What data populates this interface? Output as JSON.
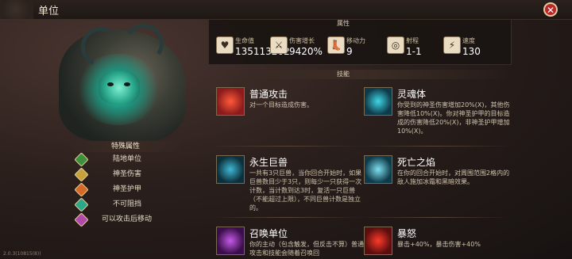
{
  "window": {
    "title": "单位"
  },
  "version": "2.0.3(10815(8))",
  "attributes": {
    "header": "特殊属性",
    "items": [
      {
        "label": "陆地单位",
        "icon": "land-unit-icon",
        "color": "#3f8f3f"
      },
      {
        "label": "神圣伤害",
        "icon": "holy-damage-icon",
        "color": "#c8a23a"
      },
      {
        "label": "神圣护甲",
        "icon": "holy-armor-icon",
        "color": "#d46a2a"
      },
      {
        "label": "不可阻挡",
        "icon": "unstoppable-icon",
        "color": "#2aa88c"
      },
      {
        "label": "可以攻击后移动",
        "icon": "move-after-attack-icon",
        "color": "#b04aa8"
      }
    ]
  },
  "stats": {
    "section_label": "属性",
    "items": [
      {
        "label": "生命值",
        "value": "135113202",
        "icon": "heart-icon",
        "glyph": "♥"
      },
      {
        "label": "伤害增长",
        "value": "9420%",
        "icon": "damage-growth-icon",
        "glyph": "⚔"
      },
      {
        "label": "移动力",
        "value": "9",
        "icon": "boot-icon",
        "glyph": "👢"
      },
      {
        "label": "射程",
        "value": "1-1",
        "icon": "target-icon",
        "glyph": "◎"
      },
      {
        "label": "速度",
        "value": "130",
        "icon": "lightning-icon",
        "glyph": "⚡"
      }
    ]
  },
  "skills": {
    "section_label": "技能",
    "items": [
      {
        "name": "普通攻击",
        "desc": "对一个目标造成伤害。",
        "icon": "sword-slash-icon",
        "bg": "#8c1c1c",
        "fg": "#ff5a3a"
      },
      {
        "name": "灵魂体",
        "desc": "你受到的神圣伤害增加20%(X)，其他伤害降低10%(X)。你对神圣护甲的目标造成的伤害降低20%(X)，非神圣护甲增加10%(X)。",
        "icon": "spirit-icon",
        "bg": "#0e3b4a",
        "fg": "#3fd6e6"
      },
      {
        "name": "永生巨兽",
        "desc": "一共有3只巨兽，当你回合开始时，如果巨兽数目少于3只，则每少一只获得一次计数，当计数到达3时，复活一只巨兽（不能超过上限），不同巨兽计数是独立的。",
        "icon": "immortal-beast-icon",
        "bg": "#0c2f3a",
        "fg": "#3fb8d6"
      },
      {
        "name": "死亡之焰",
        "desc": "在你的回合开始时，对周围范围2格内的敌人施加冰霜和黑暗效果。",
        "icon": "death-flame-icon",
        "bg": "#0e3b4a",
        "fg": "#7fe0f0"
      },
      {
        "name": "召唤单位",
        "desc": "你的主动（包含触发，但反击不算）普通攻击和技能会随着召唤回",
        "icon": "summon-icon",
        "bg": "#3a0e4a",
        "fg": "#c45ae6"
      },
      {
        "name": "暴怒",
        "desc": "暴击+40%，暴击伤害+40%",
        "icon": "rage-icon",
        "bg": "#5a0e0e",
        "fg": "#ff3a2a"
      }
    ]
  }
}
